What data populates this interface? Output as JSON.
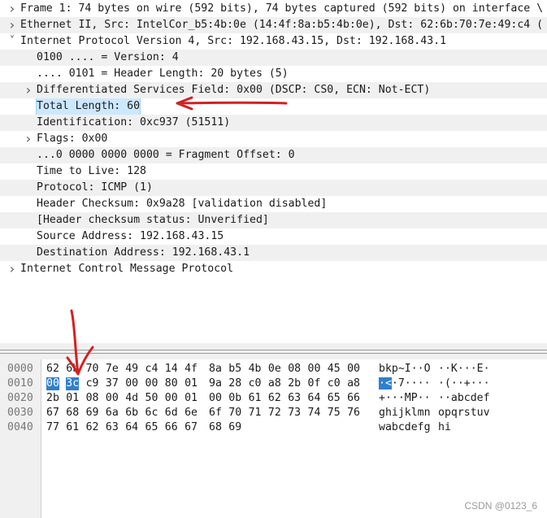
{
  "tree": {
    "rows": [
      {
        "text": "Frame 1: 74 bytes on wire (592 bits), 74 bytes captured (592 bits) on interface \\",
        "toggle": ">",
        "indent": 0
      },
      {
        "text": "Ethernet II, Src: IntelCor_b5:4b:0e (14:4f:8a:b5:4b:0e), Dst: 62:6b:70:7e:49:c4 (",
        "toggle": ">",
        "indent": 0
      },
      {
        "text": "Internet Protocol Version 4, Src: 192.168.43.15, Dst: 192.168.43.1",
        "toggle": "v",
        "indent": 0
      },
      {
        "text": "0100 .... = Version: 4",
        "toggle": "",
        "indent": 1
      },
      {
        "text": ".... 0101 = Header Length: 20 bytes (5)",
        "toggle": "",
        "indent": 1
      },
      {
        "text": "Differentiated Services Field: 0x00 (DSCP: CS0, ECN: Not-ECT)",
        "toggle": ">",
        "indent": 1
      },
      {
        "text": "Total Length: 60",
        "toggle": "",
        "indent": 1,
        "selected": true
      },
      {
        "text": "Identification: 0xc937 (51511)",
        "toggle": "",
        "indent": 1
      },
      {
        "text": "Flags: 0x00",
        "toggle": ">",
        "indent": 1
      },
      {
        "text": "...0 0000 0000 0000 = Fragment Offset: 0",
        "toggle": "",
        "indent": 1
      },
      {
        "text": "Time to Live: 128",
        "toggle": "",
        "indent": 1
      },
      {
        "text": "Protocol: ICMP (1)",
        "toggle": "",
        "indent": 1
      },
      {
        "text": "Header Checksum: 0x9a28 [validation disabled]",
        "toggle": "",
        "indent": 1
      },
      {
        "text": "[Header checksum status: Unverified]",
        "toggle": "",
        "indent": 1
      },
      {
        "text": "Source Address: 192.168.43.15",
        "toggle": "",
        "indent": 1
      },
      {
        "text": "Destination Address: 192.168.43.1",
        "toggle": "",
        "indent": 1
      },
      {
        "text": "Internet Control Message Protocol",
        "toggle": ">",
        "indent": 0
      }
    ]
  },
  "hex": {
    "rows": [
      {
        "offset": "0000",
        "bytes": [
          "62",
          "6b",
          "70",
          "7e",
          "49",
          "c4",
          "14",
          "4f",
          "8a",
          "b5",
          "4b",
          "0e",
          "08",
          "00",
          "45",
          "00"
        ],
        "ascii1": "bkp~I··O",
        "ascii2": "··K···E·"
      },
      {
        "offset": "0010",
        "bytes": [
          "00",
          "3c",
          "c9",
          "37",
          "00",
          "00",
          "80",
          "01",
          "9a",
          "28",
          "c0",
          "a8",
          "2b",
          "0f",
          "c0",
          "a8"
        ],
        "ascii1": "·<·7····",
        "ascii2": "·(··+···",
        "highlight": [
          0,
          1
        ]
      },
      {
        "offset": "0020",
        "bytes": [
          "2b",
          "01",
          "08",
          "00",
          "4d",
          "50",
          "00",
          "01",
          "00",
          "0b",
          "61",
          "62",
          "63",
          "64",
          "65",
          "66"
        ],
        "ascii1": "+···MP··",
        "ascii2": "··abcdef"
      },
      {
        "offset": "0030",
        "bytes": [
          "67",
          "68",
          "69",
          "6a",
          "6b",
          "6c",
          "6d",
          "6e",
          "6f",
          "70",
          "71",
          "72",
          "73",
          "74",
          "75",
          "76"
        ],
        "ascii1": "ghijklmn",
        "ascii2": "opqrstuv"
      },
      {
        "offset": "0040",
        "bytes": [
          "77",
          "61",
          "62",
          "63",
          "64",
          "65",
          "66",
          "67",
          "68",
          "69"
        ],
        "ascii1": "wabcdefg",
        "ascii2": "hi"
      }
    ]
  },
  "watermark": "CSDN @0123_6",
  "colors": {
    "selected_row": "#cce8ff",
    "hex_highlight": "#2f7fd0",
    "annotation": "#d42020"
  },
  "icons": {
    "collapsed": "chevron-right-icon",
    "expanded": "chevron-down-icon"
  }
}
